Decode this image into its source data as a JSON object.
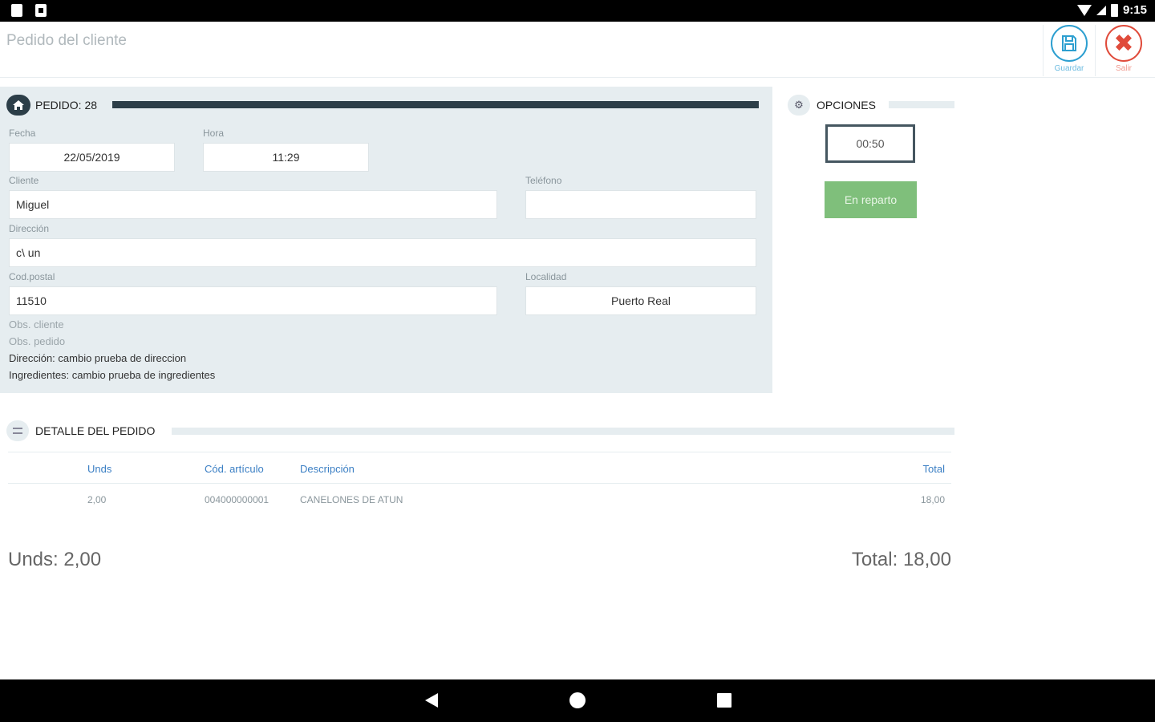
{
  "status_bar": {
    "time": "9:15"
  },
  "header": {
    "title": "Pedido del cliente",
    "save_label": "Guardar",
    "exit_label": "Salir"
  },
  "order": {
    "title": "PEDIDO: 28",
    "fecha_label": "Fecha",
    "fecha_value": "22/05/2019",
    "hora_label": "Hora",
    "hora_value": "11:29",
    "cliente_label": "Cliente",
    "cliente_value": "Miguel",
    "telefono_label": "Teléfono",
    "telefono_value": "",
    "direccion_label": "Dirección",
    "direccion_value": "c\\ un",
    "cp_label": "Cod.postal",
    "cp_value": "11510",
    "localidad_label": "Localidad",
    "localidad_value": "Puerto Real",
    "obs_cliente_label": "Obs. cliente",
    "obs_pedido_label": "Obs. pedido",
    "obs_line1": "Dirección: cambio prueba de direccion",
    "obs_line2": "Ingredientes: cambio prueba de ingredientes"
  },
  "options": {
    "title": "OPCIONES",
    "time": "00:50",
    "status_button": "En reparto",
    "status_color": "#7fbf7b"
  },
  "detail": {
    "title": "DETALLE DEL PEDIDO",
    "columns": {
      "units": "Unds",
      "code": "Cód. artículo",
      "desc": "Descripción",
      "total": "Total"
    },
    "rows": [
      {
        "units": "2,00",
        "code": "004000000001",
        "desc": "CANELONES DE ATUN",
        "total": "18,00"
      }
    ],
    "sum_units": "Unds: 2,00",
    "sum_total": "Total: 18,00"
  }
}
